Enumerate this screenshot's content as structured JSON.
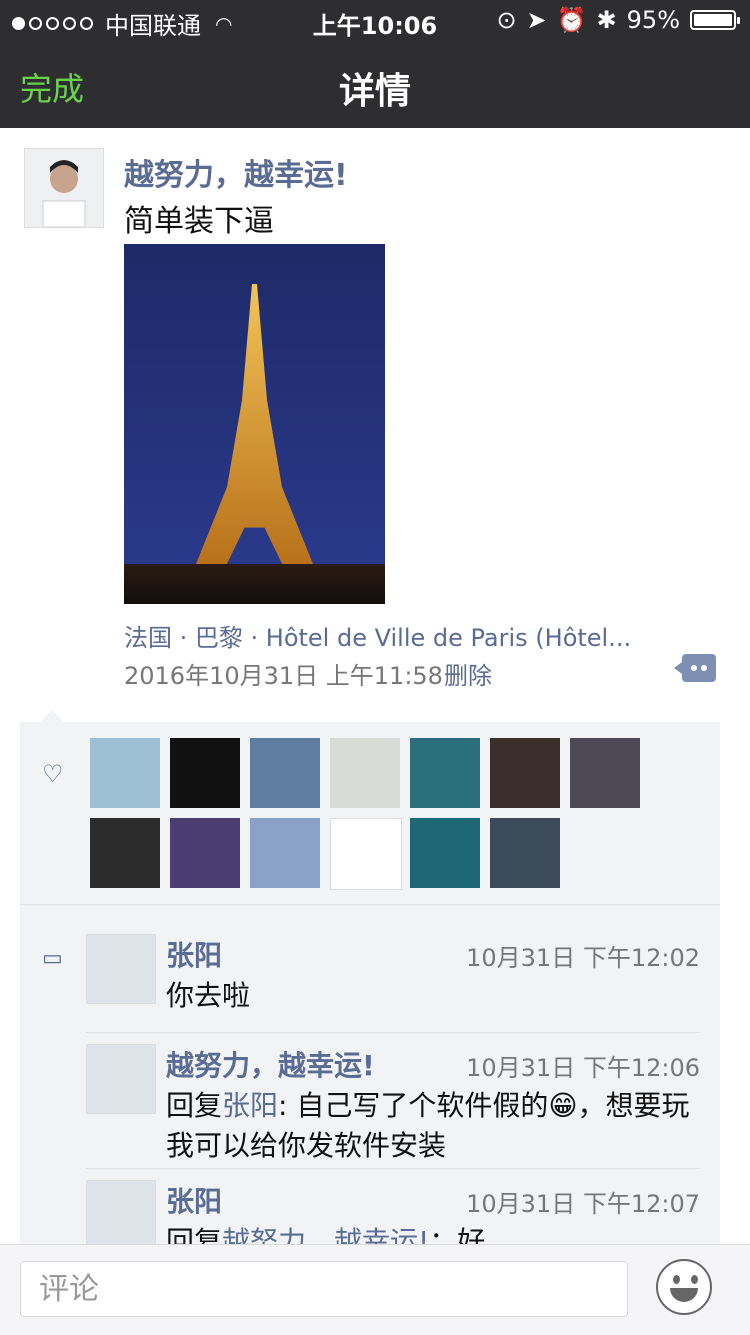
{
  "status_bar": {
    "carrier": "中国联通",
    "time": "上午10:06",
    "battery": "95%"
  },
  "nav": {
    "done": "完成",
    "title": "详情"
  },
  "post": {
    "author": "越努力，越幸运!",
    "text": "简单装下逼",
    "location": "法国 · 巴黎 · Hôtel de Ville de Paris (Hôtel...",
    "timestamp": "2016年10月31日 上午11:58",
    "delete_label": "删除"
  },
  "likes": {
    "icon": "heart-icon",
    "avatars": [
      {
        "color": "#9ec0d7"
      },
      {
        "color": "#111111"
      },
      {
        "color": "#5f7da1"
      },
      {
        "color": "#d9dbd7"
      },
      {
        "color": "#2b6e7c"
      },
      {
        "color": "#3a2f2a"
      },
      {
        "color": "#4d4a56"
      },
      {
        "color": "#2c2c2c"
      },
      {
        "color": "#4b3c71"
      },
      {
        "color": "#8aa2c7"
      },
      {
        "color": "#ffffff"
      },
      {
        "color": "#1e6875"
      },
      {
        "color": "#3b4b5a"
      }
    ]
  },
  "comments": [
    {
      "name": "张阳",
      "time": "10月31日 下午12:02",
      "text": "你去啦"
    },
    {
      "name": "越努力，越幸运!",
      "time": "10月31日 下午12:06",
      "reply_prefix": "回复",
      "reply_to": "张阳",
      "text": ": 自己写了个软件假的😁，想要玩我可以给你发软件安装"
    },
    {
      "name": "张阳",
      "time": "10月31日 下午12:07",
      "reply_prefix": "回复",
      "reply_to": "越努力，越幸运!",
      "text": "：好"
    }
  ],
  "bottom_bar": {
    "comment_placeholder": "评论",
    "emoji_icon": "emoji-icon"
  }
}
